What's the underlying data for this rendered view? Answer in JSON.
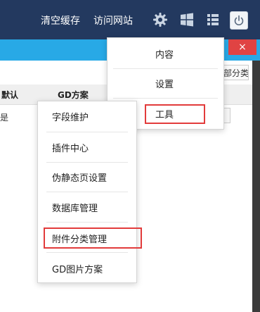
{
  "topbar": {
    "clear_cache": "清空缓存",
    "visit_site": "访问网站",
    "icons": [
      "gear-icon",
      "windows-icon",
      "list-icon",
      "power-icon"
    ]
  },
  "window": {
    "close": "×"
  },
  "toolbar": {
    "button_label": "部分类"
  },
  "table": {
    "headers": [
      "默认",
      "GD方案"
    ],
    "row_cell": "是"
  },
  "main_menu": {
    "items": [
      "内容",
      "设置",
      "工具"
    ]
  },
  "sub_menu": {
    "items": [
      "字段维护",
      "插件中心",
      "伪静态页设置",
      "数据库管理",
      "附件分类管理",
      "GD图片方案"
    ]
  },
  "colors": {
    "topbar": "#23395f",
    "bluebar": "#28a9e6",
    "close": "#e04343",
    "highlight": "#e23b3b"
  }
}
